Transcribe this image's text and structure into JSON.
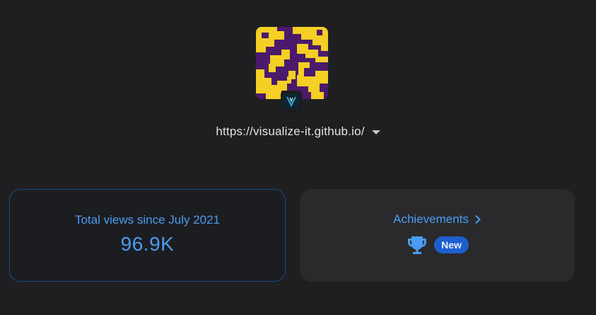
{
  "site": {
    "url": "https://visualize-it.github.io/",
    "avatar_icon": "site-pattern-thumbnail",
    "favicon_icon": "visualize-it-v-logo"
  },
  "views_card": {
    "label": "Total views since July 2021",
    "value": "96.9K"
  },
  "achievements_card": {
    "label": "Achievements",
    "trophy_icon": "trophy-icon",
    "badge": "New"
  },
  "colors": {
    "background": "#1f1f21",
    "accent_blue": "#4a9cf2",
    "badge_blue": "#1d5fcf",
    "avatar_yellow": "#f5d224",
    "avatar_purple": "#4a1a6b"
  }
}
